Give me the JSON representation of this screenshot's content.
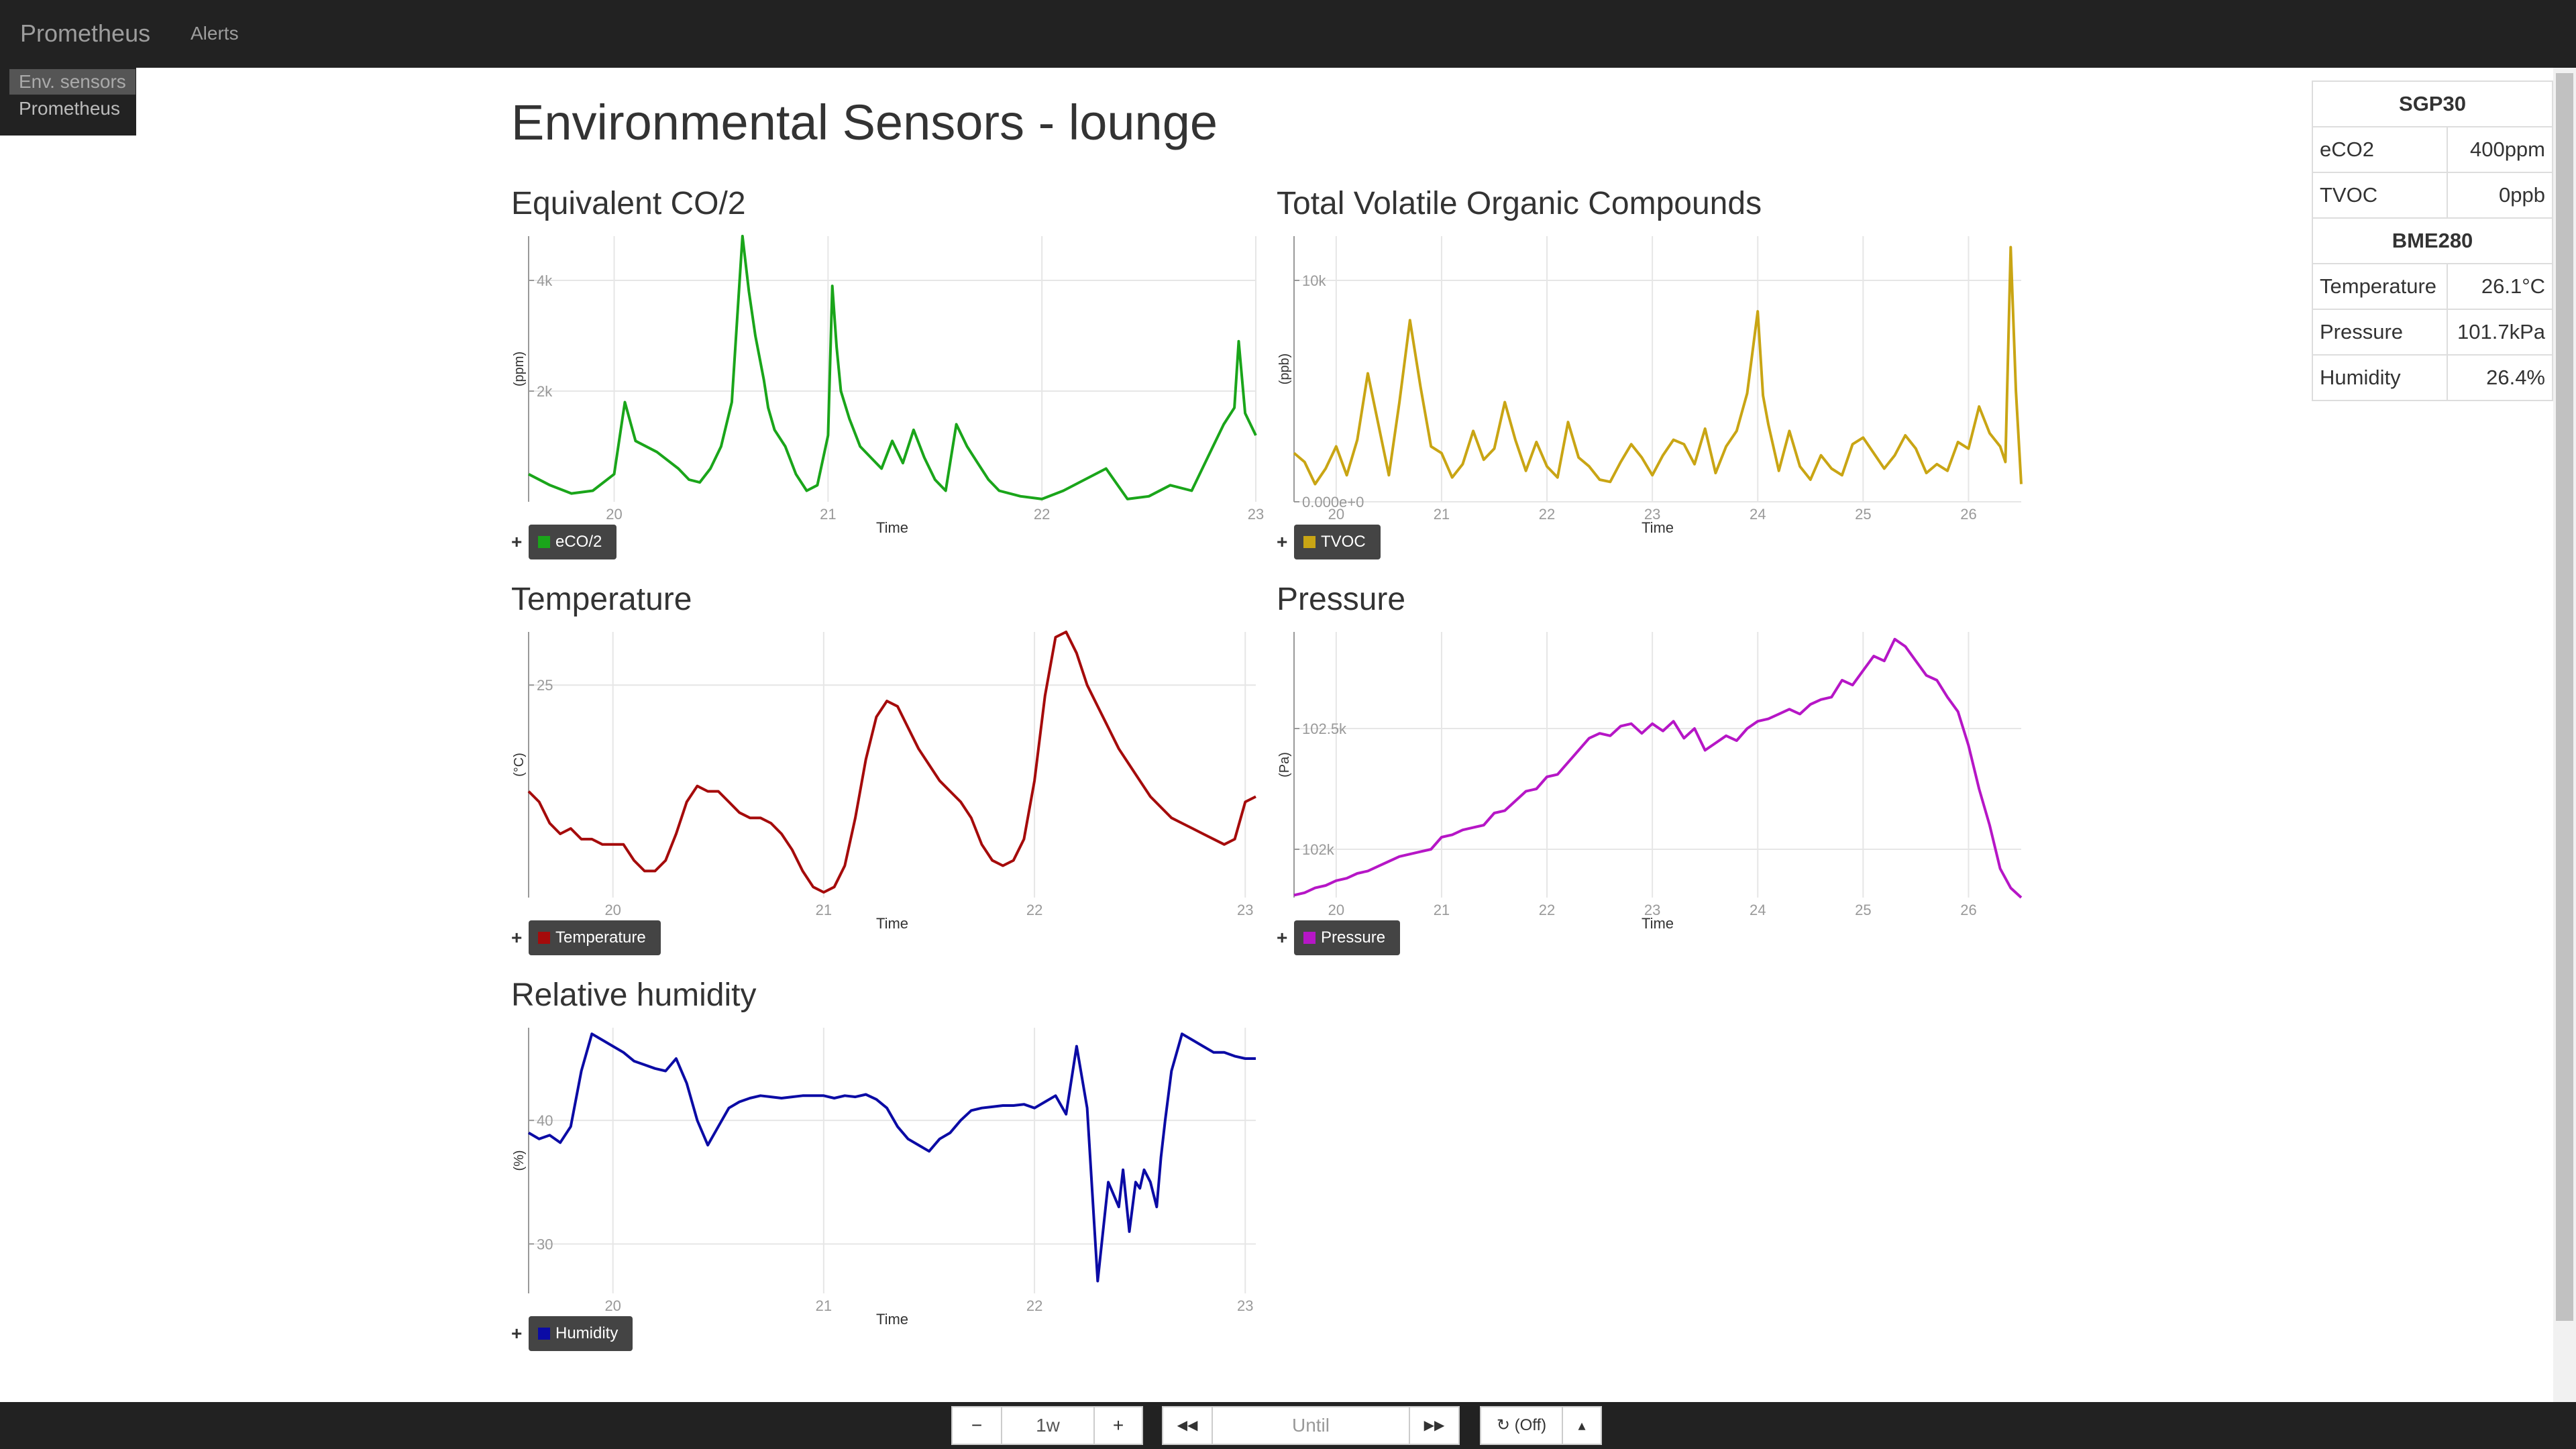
{
  "navbar": {
    "brand": "Prometheus",
    "alerts": "Alerts"
  },
  "console_menu": {
    "items": [
      {
        "label": "Env. sensors",
        "active": true
      },
      {
        "label": "Prometheus",
        "active": false
      }
    ]
  },
  "page_title": "Environmental Sensors - lounge",
  "sensor_table": {
    "groups": [
      {
        "name": "SGP30",
        "rows": [
          {
            "label": "eCO2",
            "value": "400ppm"
          },
          {
            "label": "TVOC",
            "value": "0ppb"
          }
        ]
      },
      {
        "name": "BME280",
        "rows": [
          {
            "label": "Temperature",
            "value": "26.1°C"
          },
          {
            "label": "Pressure",
            "value": "101.7kPa"
          },
          {
            "label": "Humidity",
            "value": "26.4%"
          }
        ]
      }
    ]
  },
  "bottom_bar": {
    "minus": "−",
    "range": "1w",
    "plus": "+",
    "back": "◀◀",
    "until_placeholder": "Until",
    "forward": "▶▶",
    "refresh": "↻ (Off)",
    "caret": "▴"
  },
  "colors": {
    "eco2": "#1aa51a",
    "tvoc": "#c9a514",
    "temperature": "#a50b0b",
    "pressure": "#b616c6",
    "humidity": "#0b0ba5",
    "navbar": "#222222"
  },
  "chart_data": [
    {
      "id": "eco2",
      "type": "line",
      "title": "Equivalent CO/2",
      "xlabel": "Time",
      "ylabel": "(ppm)",
      "xlim": [
        19.6,
        23.0
      ],
      "ylim": [
        0,
        4800
      ],
      "xticks": [
        20,
        21,
        22,
        23
      ],
      "xticklabels": [
        "20",
        "21",
        "22",
        "23"
      ],
      "yticks": [
        2000,
        4000
      ],
      "yticklabels": [
        "2k",
        "4k"
      ],
      "series": [
        {
          "name": "eCO/2",
          "color": "#1aa51a",
          "x": [
            19.6,
            19.7,
            19.8,
            19.9,
            20.0,
            20.05,
            20.1,
            20.2,
            20.3,
            20.35,
            20.4,
            20.45,
            20.5,
            20.55,
            20.6,
            20.63,
            20.66,
            20.7,
            20.72,
            20.75,
            20.8,
            20.85,
            20.9,
            20.95,
            21.0,
            21.02,
            21.04,
            21.06,
            21.1,
            21.15,
            21.2,
            21.25,
            21.3,
            21.35,
            21.4,
            21.45,
            21.5,
            21.55,
            21.6,
            21.65,
            21.7,
            21.75,
            21.8,
            21.9,
            22.0,
            22.1,
            22.2,
            22.3,
            22.4,
            22.5,
            22.6,
            22.7,
            22.75,
            22.8,
            22.85,
            22.9,
            22.92,
            22.95,
            23.0
          ],
          "y": [
            500,
            300,
            150,
            200,
            500,
            1800,
            1100,
            900,
            600,
            400,
            350,
            600,
            1000,
            1800,
            4800,
            3800,
            3000,
            2200,
            1700,
            1300,
            1000,
            500,
            200,
            300,
            1200,
            3900,
            2800,
            2000,
            1500,
            1000,
            800,
            600,
            1100,
            700,
            1300,
            800,
            400,
            200,
            1400,
            1000,
            700,
            400,
            200,
            100,
            50,
            200,
            400,
            600,
            50,
            100,
            300,
            200,
            600,
            1000,
            1400,
            1700,
            2900,
            1600,
            1200
          ]
        }
      ]
    },
    {
      "id": "tvoc",
      "type": "line",
      "title": "Total Volatile Organic Compounds",
      "xlabel": "Time",
      "ylabel": "(ppb)",
      "xlim": [
        19.6,
        26.5
      ],
      "ylim": [
        0,
        12000
      ],
      "xticks": [
        20,
        21,
        22,
        23,
        24,
        25,
        26
      ],
      "xticklabels": [
        "20",
        "21",
        "22",
        "23",
        "24",
        "25",
        "26"
      ],
      "yticks": [
        0,
        10000
      ],
      "yticklabels": [
        "0.000e+0",
        "10k"
      ],
      "series": [
        {
          "name": "TVOC",
          "color": "#c9a514",
          "x": [
            19.6,
            19.7,
            19.8,
            19.9,
            20.0,
            20.1,
            20.2,
            20.3,
            20.4,
            20.5,
            20.6,
            20.7,
            20.8,
            20.9,
            21.0,
            21.1,
            21.2,
            21.3,
            21.4,
            21.5,
            21.6,
            21.7,
            21.8,
            21.9,
            22.0,
            22.1,
            22.2,
            22.3,
            22.4,
            22.5,
            22.6,
            22.7,
            22.8,
            22.9,
            23.0,
            23.1,
            23.2,
            23.3,
            23.4,
            23.5,
            23.6,
            23.7,
            23.8,
            23.9,
            24.0,
            24.05,
            24.1,
            24.2,
            24.3,
            24.4,
            24.5,
            24.6,
            24.7,
            24.8,
            24.9,
            25.0,
            25.1,
            25.2,
            25.3,
            25.4,
            25.5,
            25.6,
            25.7,
            25.8,
            25.9,
            26.0,
            26.1,
            26.2,
            26.3,
            26.35,
            26.4,
            26.45,
            26.5
          ],
          "y": [
            2200,
            1800,
            800,
            1500,
            2500,
            1200,
            2800,
            5800,
            3500,
            1200,
            4500,
            8200,
            5200,
            2500,
            2200,
            1100,
            1700,
            3200,
            1900,
            2400,
            4500,
            2800,
            1400,
            2700,
            1600,
            1100,
            3600,
            2000,
            1600,
            1000,
            900,
            1800,
            2600,
            2000,
            1200,
            2100,
            2800,
            2600,
            1700,
            3300,
            1300,
            2500,
            3200,
            4900,
            8600,
            4800,
            3500,
            1400,
            3200,
            1600,
            1000,
            2100,
            1500,
            1200,
            2600,
            2900,
            2200,
            1500,
            2100,
            3000,
            2400,
            1300,
            1700,
            1400,
            2700,
            2400,
            4300,
            3100,
            2500,
            1800,
            11500,
            5000,
            800
          ]
        }
      ]
    },
    {
      "id": "temperature",
      "type": "line",
      "title": "Temperature",
      "xlabel": "Time",
      "ylabel": "(°C)",
      "xlim": [
        19.6,
        23.05
      ],
      "ylim": [
        21,
        26
      ],
      "xticks": [
        20,
        21,
        22,
        23
      ],
      "xticklabels": [
        "20",
        "21",
        "22",
        "23"
      ],
      "yticks": [
        25
      ],
      "yticklabels": [
        "25"
      ],
      "series": [
        {
          "name": "Temperature",
          "color": "#a50b0b",
          "x": [
            19.6,
            19.65,
            19.7,
            19.75,
            19.8,
            19.85,
            19.9,
            19.95,
            20.0,
            20.05,
            20.1,
            20.15,
            20.2,
            20.25,
            20.3,
            20.35,
            20.4,
            20.45,
            20.5,
            20.55,
            20.6,
            20.65,
            20.7,
            20.75,
            20.8,
            20.85,
            20.9,
            20.95,
            21.0,
            21.05,
            21.1,
            21.15,
            21.2,
            21.25,
            21.3,
            21.35,
            21.4,
            21.45,
            21.5,
            21.55,
            21.6,
            21.65,
            21.7,
            21.75,
            21.8,
            21.85,
            21.9,
            21.95,
            22.0,
            22.05,
            22.1,
            22.15,
            22.2,
            22.25,
            22.3,
            22.35,
            22.4,
            22.45,
            22.5,
            22.55,
            22.6,
            22.65,
            22.7,
            22.75,
            22.8,
            22.85,
            22.9,
            22.95,
            23.0,
            23.05
          ],
          "y": [
            23.0,
            22.8,
            22.4,
            22.2,
            22.3,
            22.1,
            22.1,
            22.0,
            22.0,
            22.0,
            21.7,
            21.5,
            21.5,
            21.7,
            22.2,
            22.8,
            23.1,
            23.0,
            23.0,
            22.8,
            22.6,
            22.5,
            22.5,
            22.4,
            22.2,
            21.9,
            21.5,
            21.2,
            21.1,
            21.2,
            21.6,
            22.5,
            23.6,
            24.4,
            24.7,
            24.6,
            24.2,
            23.8,
            23.5,
            23.2,
            23.0,
            22.8,
            22.5,
            22.0,
            21.7,
            21.6,
            21.7,
            22.1,
            23.2,
            24.8,
            25.9,
            26.0,
            25.6,
            25.0,
            24.6,
            24.2,
            23.8,
            23.5,
            23.2,
            22.9,
            22.7,
            22.5,
            22.4,
            22.3,
            22.2,
            22.1,
            22.0,
            22.1,
            22.8,
            22.9
          ]
        }
      ]
    },
    {
      "id": "pressure",
      "type": "line",
      "title": "Pressure",
      "xlabel": "Time",
      "ylabel": "(Pa)",
      "xlim": [
        19.6,
        26.5
      ],
      "ylim": [
        101800,
        102900
      ],
      "xticks": [
        20,
        21,
        22,
        23,
        24,
        25,
        26
      ],
      "xticklabels": [
        "20",
        "21",
        "22",
        "23",
        "24",
        "25",
        "26"
      ],
      "yticks": [
        102000,
        102500
      ],
      "yticklabels": [
        "102k",
        "102.5k"
      ],
      "series": [
        {
          "name": "Pressure",
          "color": "#b616c6",
          "x": [
            19.6,
            19.7,
            19.8,
            19.9,
            20.0,
            20.1,
            20.2,
            20.3,
            20.4,
            20.5,
            20.6,
            20.7,
            20.8,
            20.9,
            21.0,
            21.1,
            21.2,
            21.3,
            21.4,
            21.5,
            21.6,
            21.7,
            21.8,
            21.9,
            22.0,
            22.1,
            22.2,
            22.3,
            22.4,
            22.5,
            22.6,
            22.7,
            22.8,
            22.9,
            23.0,
            23.1,
            23.2,
            23.3,
            23.4,
            23.5,
            23.6,
            23.7,
            23.8,
            23.9,
            24.0,
            24.1,
            24.2,
            24.3,
            24.4,
            24.5,
            24.6,
            24.7,
            24.8,
            24.9,
            25.0,
            25.1,
            25.2,
            25.3,
            25.4,
            25.5,
            25.6,
            25.7,
            25.8,
            25.9,
            26.0,
            26.1,
            26.2,
            26.3,
            26.4,
            26.5
          ],
          "y": [
            101810,
            101820,
            101840,
            101850,
            101870,
            101880,
            101900,
            101910,
            101930,
            101950,
            101970,
            101980,
            101990,
            102000,
            102050,
            102060,
            102080,
            102090,
            102100,
            102150,
            102160,
            102200,
            102240,
            102250,
            102300,
            102310,
            102360,
            102410,
            102460,
            102480,
            102470,
            102510,
            102520,
            102480,
            102520,
            102490,
            102530,
            102460,
            102500,
            102410,
            102440,
            102470,
            102450,
            102500,
            102530,
            102540,
            102560,
            102580,
            102560,
            102600,
            102620,
            102630,
            102700,
            102680,
            102740,
            102800,
            102780,
            102870,
            102840,
            102780,
            102720,
            102700,
            102630,
            102570,
            102430,
            102250,
            102100,
            101920,
            101840,
            101800
          ]
        }
      ]
    },
    {
      "id": "humidity",
      "type": "line",
      "title": "Relative humidity",
      "xlabel": "Time",
      "ylabel": "(%)",
      "xlim": [
        19.6,
        23.05
      ],
      "ylim": [
        26,
        47.5
      ],
      "xticks": [
        20,
        21,
        22,
        23
      ],
      "xticklabels": [
        "20",
        "21",
        "22",
        "23"
      ],
      "yticks": [
        30,
        40
      ],
      "yticklabels": [
        "30",
        "40"
      ],
      "series": [
        {
          "name": "Humidity",
          "color": "#0b0ba5",
          "x": [
            19.6,
            19.65,
            19.7,
            19.75,
            19.8,
            19.85,
            19.9,
            19.95,
            20.0,
            20.05,
            20.1,
            20.15,
            20.2,
            20.25,
            20.3,
            20.35,
            20.4,
            20.45,
            20.5,
            20.55,
            20.6,
            20.65,
            20.7,
            20.75,
            20.8,
            20.85,
            20.9,
            20.95,
            21.0,
            21.05,
            21.1,
            21.15,
            21.2,
            21.25,
            21.3,
            21.35,
            21.4,
            21.45,
            21.5,
            21.55,
            21.6,
            21.65,
            21.7,
            21.75,
            21.8,
            21.85,
            21.9,
            21.95,
            22.0,
            22.05,
            22.1,
            22.15,
            22.2,
            22.25,
            22.3,
            22.35,
            22.4,
            22.42,
            22.45,
            22.48,
            22.5,
            22.52,
            22.55,
            22.58,
            22.6,
            22.62,
            22.65,
            22.7,
            22.75,
            22.8,
            22.85,
            22.9,
            22.95,
            23.0,
            23.05
          ],
          "y": [
            39,
            38.5,
            38.8,
            38.2,
            39.5,
            44,
            47,
            46.5,
            46,
            45.5,
            44.8,
            44.5,
            44.2,
            44,
            45,
            43,
            40,
            38,
            39.5,
            41,
            41.5,
            41.8,
            42,
            41.9,
            41.8,
            41.9,
            42,
            42,
            42,
            41.8,
            42,
            41.9,
            42.1,
            41.7,
            41,
            39.5,
            38.5,
            38,
            37.5,
            38.5,
            39,
            40,
            40.8,
            41,
            41.1,
            41.2,
            41.2,
            41.3,
            41,
            41.5,
            42,
            40.5,
            46,
            41,
            27,
            35,
            33,
            36,
            31,
            35,
            34.5,
            36,
            35,
            33,
            37,
            40,
            44,
            47,
            46.5,
            46,
            45.5,
            45.5,
            45.2,
            45,
            45
          ]
        }
      ]
    }
  ]
}
